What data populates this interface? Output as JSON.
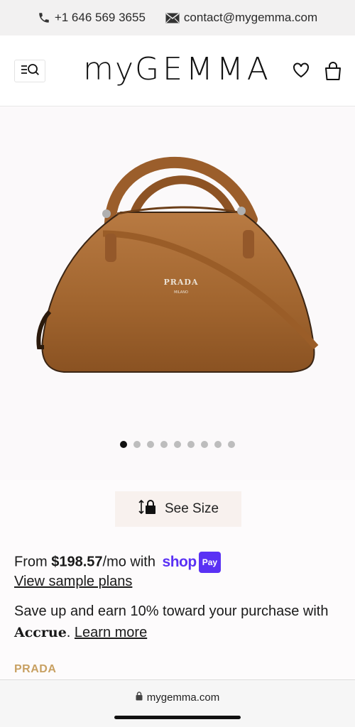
{
  "topbar": {
    "phone": "+1 646 569 3655",
    "email": "contact@mygemma.com"
  },
  "header": {
    "logo_lower": "my",
    "logo_upper": "GEMMA"
  },
  "gallery": {
    "dot_count": 9,
    "active_index": 0
  },
  "size": {
    "label": "See Size"
  },
  "financing": {
    "prefix": "From ",
    "amount": "$198.57",
    "suffix": "/mo with",
    "shop_label": "shop",
    "pay_label": "Pay",
    "plans_link": "View sample plans"
  },
  "accrue": {
    "text_before": "Save up and earn 10% toward your purchase with ",
    "brand": "Accrue",
    "period": ".",
    "link": "Learn more"
  },
  "product": {
    "brand": "PRADA",
    "image_label": "PRADA",
    "image_sublabel": "MILANO"
  },
  "browser": {
    "url": "mygemma.com"
  },
  "colors": {
    "accent_gold": "#c8a062",
    "shop_pay": "#5a31f4",
    "bag_brown": "#a0642e"
  }
}
